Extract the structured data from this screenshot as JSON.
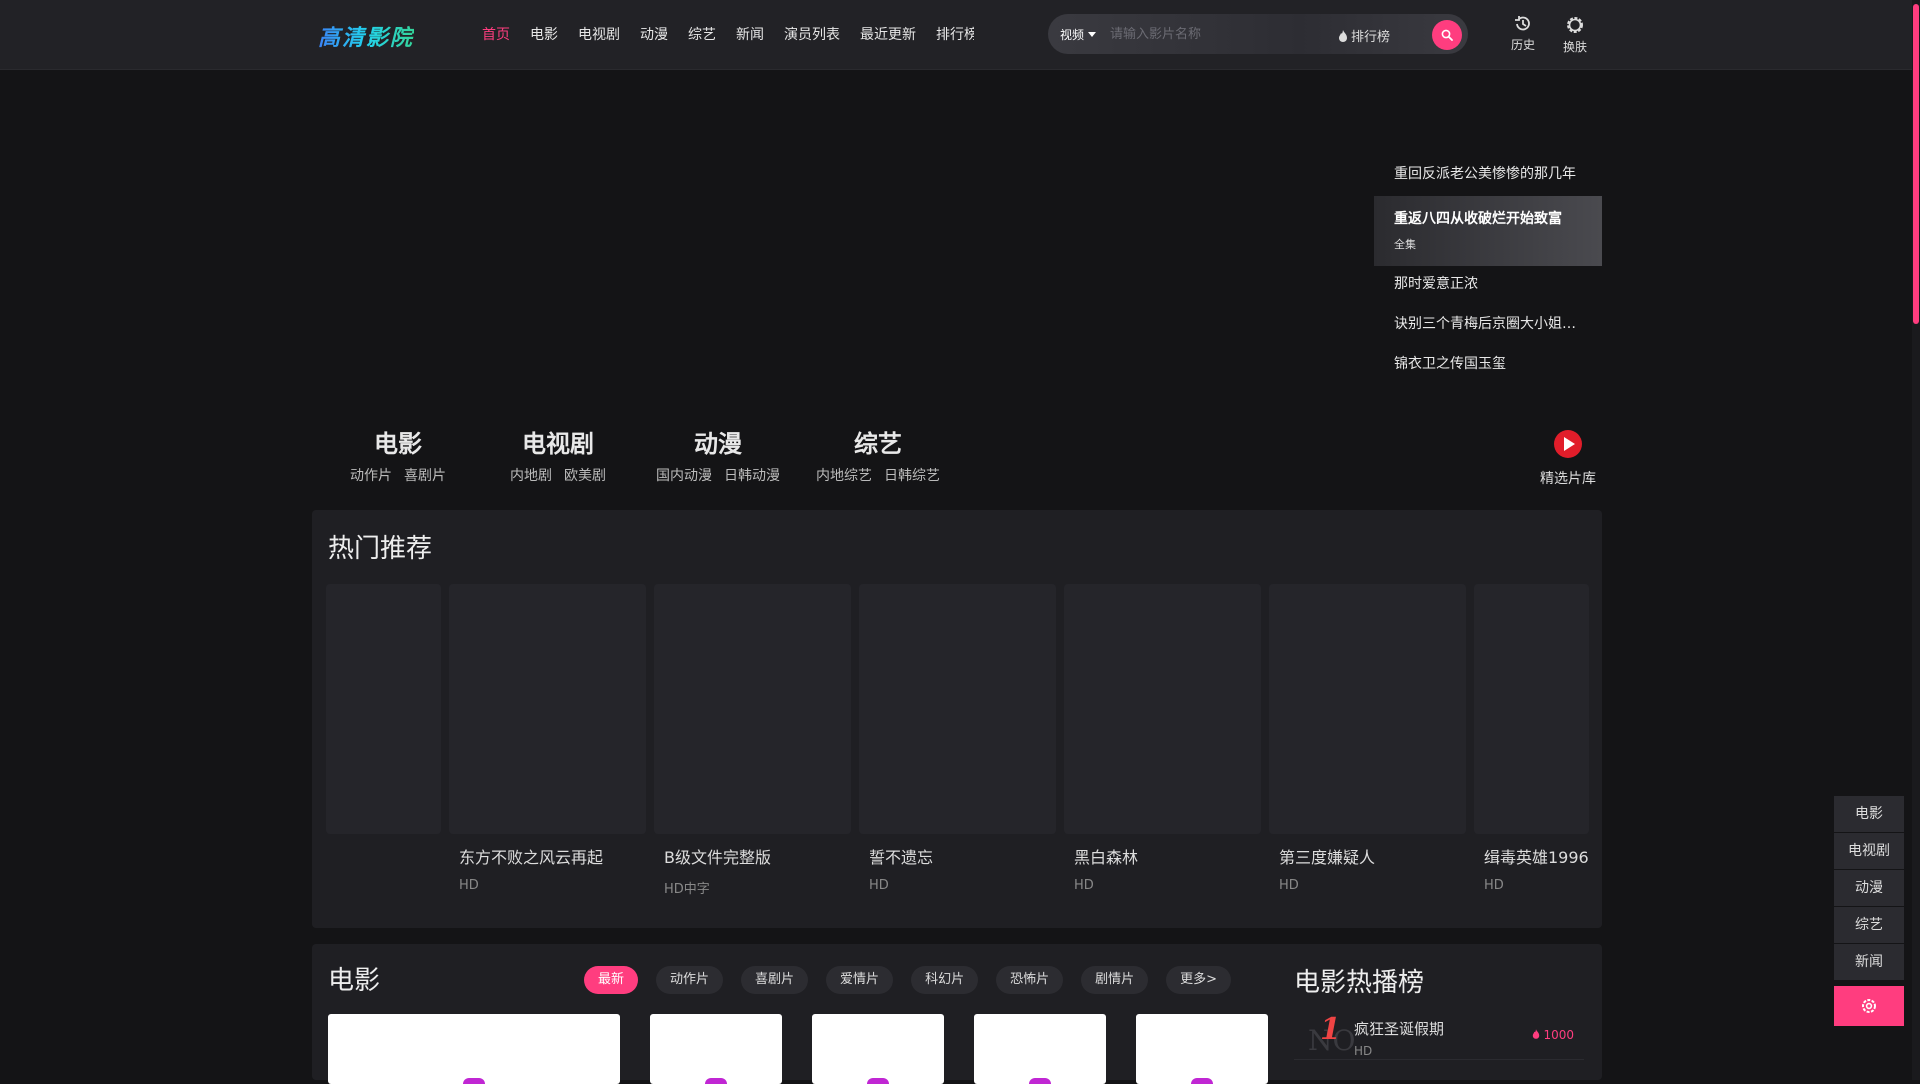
{
  "header": {
    "logo": "高清影院",
    "nav": [
      "首页",
      "电影",
      "电视剧",
      "动漫",
      "综艺",
      "新闻",
      "演员列表",
      "最近更新",
      "排行榜"
    ],
    "active_nav": "首页",
    "search": {
      "category": "视频",
      "placeholder": "请输入影片名称",
      "rank_label": "排行榜"
    },
    "icons": [
      {
        "label": "历史",
        "icon": "history-icon"
      },
      {
        "label": "换肤",
        "icon": "skin-icon"
      }
    ]
  },
  "banner": {
    "items": [
      {
        "title": "重回反派老公美惨惨的那几年"
      },
      {
        "title": "重返八四从收破烂开始致富",
        "sub": "全集",
        "active": true
      },
      {
        "title": "那时爱意正浓"
      },
      {
        "title": "诀别三个青梅后京圈大小姐…"
      },
      {
        "title": "锦衣卫之传国玉玺"
      }
    ]
  },
  "categories": [
    {
      "name": "电影",
      "subs": [
        "动作片",
        "喜剧片"
      ]
    },
    {
      "name": "电视剧",
      "subs": [
        "内地剧",
        "欧美剧"
      ]
    },
    {
      "name": "动漫",
      "subs": [
        "国内动漫",
        "日韩动漫"
      ]
    },
    {
      "name": "综艺",
      "subs": [
        "内地综艺",
        "日韩综艺"
      ]
    }
  ],
  "featured_library": "精选片库",
  "hot_recommend": {
    "title": "热门推荐",
    "cards": [
      {
        "name": "",
        "tag": ""
      },
      {
        "name": "东方不败之风云再起",
        "tag": "HD"
      },
      {
        "name": "B级文件完整版",
        "tag": "HD中字"
      },
      {
        "name": "誓不遗忘",
        "tag": "HD"
      },
      {
        "name": "黑白森林",
        "tag": "HD"
      },
      {
        "name": "第三度嫌疑人",
        "tag": "HD"
      },
      {
        "name": "缉毒英雄1996",
        "tag": "HD"
      }
    ]
  },
  "movies_section": {
    "title": "电影",
    "chips": [
      "最新",
      "动作片",
      "喜剧片",
      "爱情片",
      "科幻片",
      "恐怖片",
      "剧情片",
      "更多>"
    ],
    "active_chip": "最新"
  },
  "hot_chart": {
    "title": "电影热播榜",
    "items": [
      {
        "rank": "1",
        "no": "NO",
        "name": "疯狂圣诞假期",
        "tag": "HD",
        "heat": "1000"
      }
    ]
  },
  "side_nav": [
    "电影",
    "电视剧",
    "动漫",
    "综艺",
    "新闻"
  ],
  "colors": {
    "accent": "#ff3d7f",
    "background": "#141416",
    "panel": "#1f1f23"
  }
}
